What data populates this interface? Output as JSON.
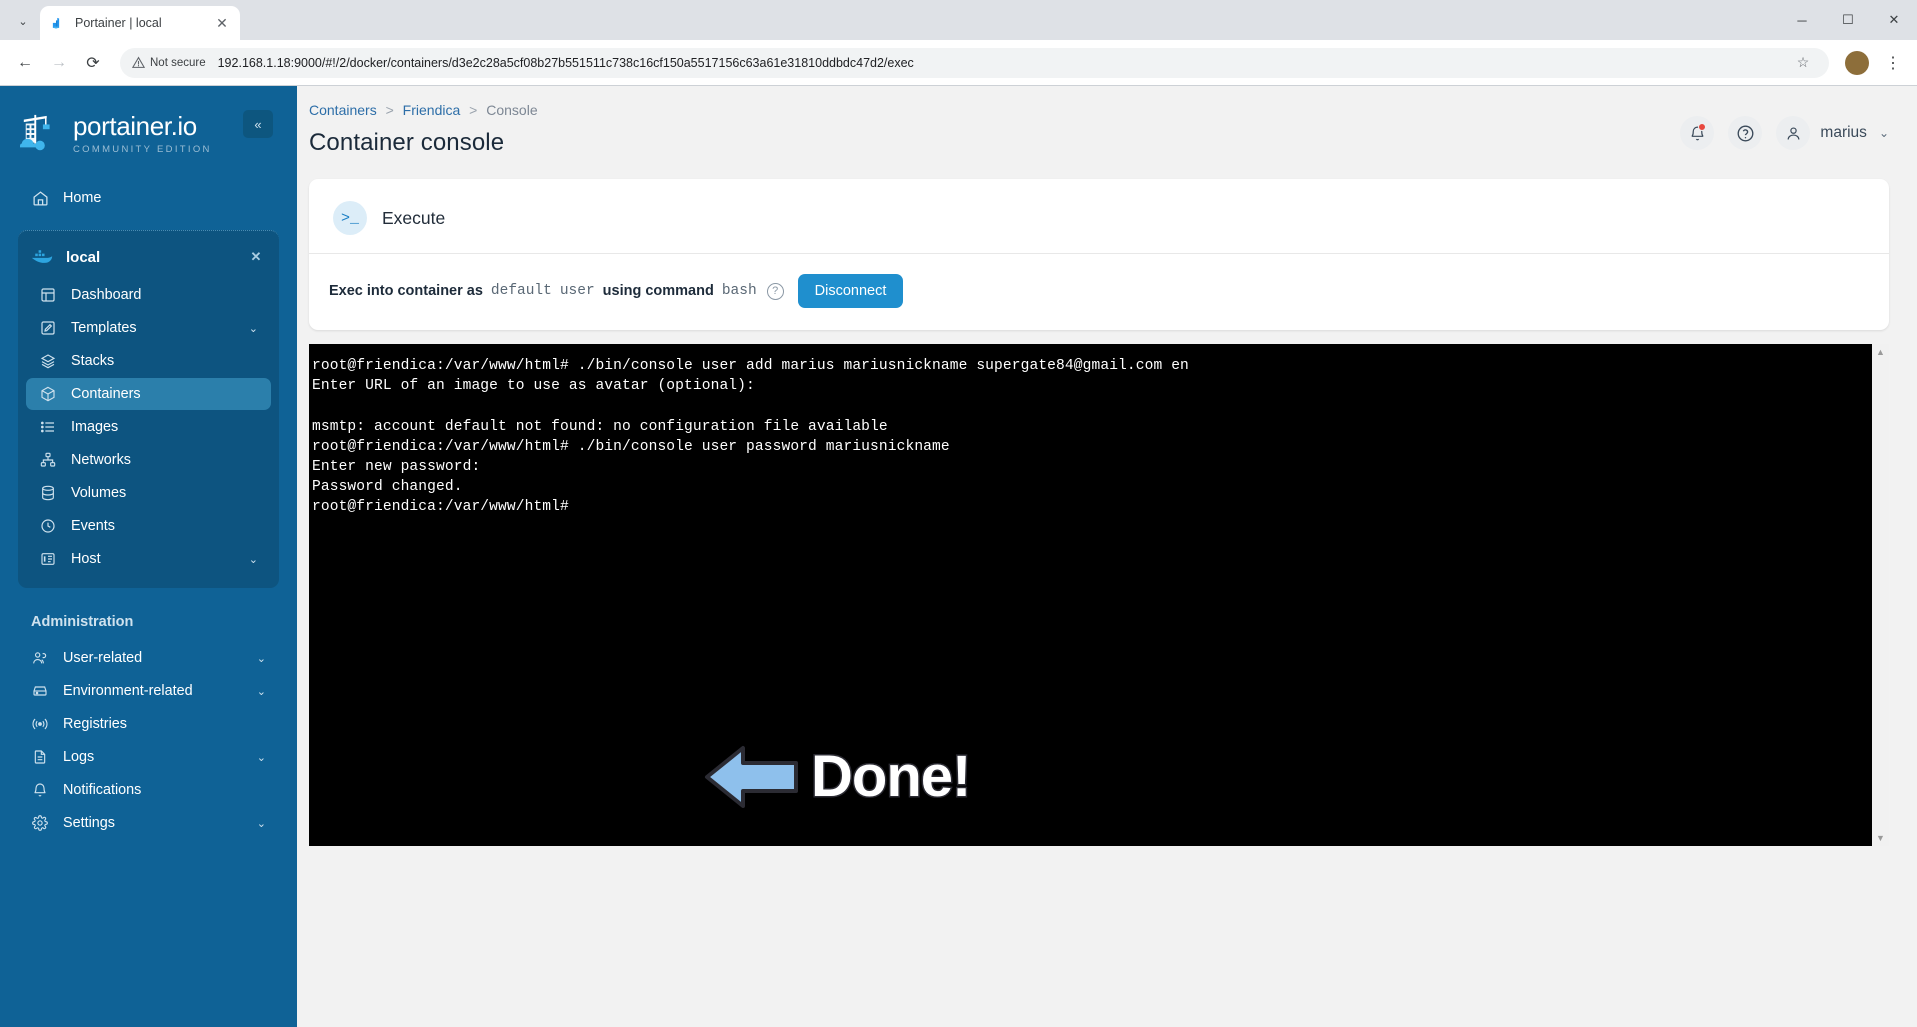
{
  "browser": {
    "tab": {
      "title": "Portainer | local",
      "favicon": "portainer-favicon",
      "close_label": "✕"
    },
    "tab_list_label": "⌄",
    "window": {
      "minimize": "─",
      "maximize": "☐",
      "close": "✕"
    },
    "nav": {
      "back": "←",
      "forward": "→",
      "reload": "⟳"
    },
    "security_label": "Not secure",
    "url": "192.168.1.18:9000/#!/2/docker/containers/d3e2c28a5cf08b27b551511c738c16cf150a5517156c63a61e31810ddbdc47d2/exec",
    "bookmark_label": "☆",
    "profile_initial": "",
    "menu_label": "⋮"
  },
  "sidebar": {
    "brand": {
      "name": "portainer.io",
      "subtitle": "COMMUNITY EDITION"
    },
    "collapse_label": "«",
    "home": {
      "label": "Home",
      "icon": "home-icon"
    },
    "environment": {
      "name": "local",
      "icon": "docker-whale-icon",
      "close_label": "✕",
      "items": [
        {
          "label": "Dashboard",
          "icon": "dashboard-icon",
          "caret": "",
          "active": false
        },
        {
          "label": "Templates",
          "icon": "templates-icon",
          "caret": "⌄",
          "active": false
        },
        {
          "label": "Stacks",
          "icon": "stacks-icon",
          "caret": "",
          "active": false
        },
        {
          "label": "Containers",
          "icon": "containers-icon",
          "caret": "",
          "active": true
        },
        {
          "label": "Images",
          "icon": "images-icon",
          "caret": "",
          "active": false
        },
        {
          "label": "Networks",
          "icon": "networks-icon",
          "caret": "",
          "active": false
        },
        {
          "label": "Volumes",
          "icon": "volumes-icon",
          "caret": "",
          "active": false
        },
        {
          "label": "Events",
          "icon": "events-icon",
          "caret": "",
          "active": false
        },
        {
          "label": "Host",
          "icon": "host-icon",
          "caret": "⌄",
          "active": false
        }
      ]
    },
    "administration": {
      "title": "Administration",
      "items": [
        {
          "label": "User-related",
          "icon": "users-icon",
          "caret": "⌄"
        },
        {
          "label": "Environment-related",
          "icon": "environment-icon",
          "caret": "⌄"
        },
        {
          "label": "Registries",
          "icon": "registries-icon",
          "caret": ""
        },
        {
          "label": "Logs",
          "icon": "logs-icon",
          "caret": "⌄"
        },
        {
          "label": "Notifications",
          "icon": "notifications-icon",
          "caret": ""
        },
        {
          "label": "Settings",
          "icon": "settings-icon",
          "caret": "⌄"
        }
      ]
    }
  },
  "header": {
    "breadcrumb": [
      {
        "label": "Containers",
        "link": true
      },
      {
        "label": "Friendica",
        "link": true
      },
      {
        "label": "Console",
        "link": false
      }
    ],
    "separator": ">",
    "title": "Container console",
    "notifications_icon": "bell-icon",
    "help_icon": "question-circle-icon",
    "user_icon": "user-icon",
    "user_name": "marius",
    "user_caret": "⌄"
  },
  "exec_card": {
    "icon": ">_",
    "title": "Execute",
    "prefix": "Exec into container as",
    "user_value": "default",
    "user_word": "user",
    "command_label": "using command",
    "command_value": "bash",
    "help_icon": "?",
    "disconnect_label": "Disconnect"
  },
  "terminal": {
    "lines": [
      "root@friendica:/var/www/html# ./bin/console user add marius mariusnickname supergate84@gmail.com en",
      "Enter URL of an image to use as avatar (optional):",
      "",
      "msmtp: account default not found: no configuration file available",
      "root@friendica:/var/www/html# ./bin/console user password mariusnickname",
      "Enter new password:",
      "Password changed.",
      "root@friendica:/var/www/html#"
    ],
    "scroll_up": "▲",
    "scroll_down": "▼"
  },
  "annotation": {
    "text": "Done!",
    "arrow_icon": "left-arrow-annotation",
    "arrow_color": "#8ec0ec",
    "arrow_outline": "#2b2b33",
    "text_color": "#ffffff"
  },
  "colors": {
    "sidebar_bg": "#0f6296",
    "sidebar_group_bg": "#0d5480",
    "sidebar_active": "#2b7fab",
    "accent_blue": "#1f8fce",
    "breadcrumb_link": "#2d6ea8",
    "terminal_bg": "#000000",
    "badge_red": "#e8483f"
  }
}
